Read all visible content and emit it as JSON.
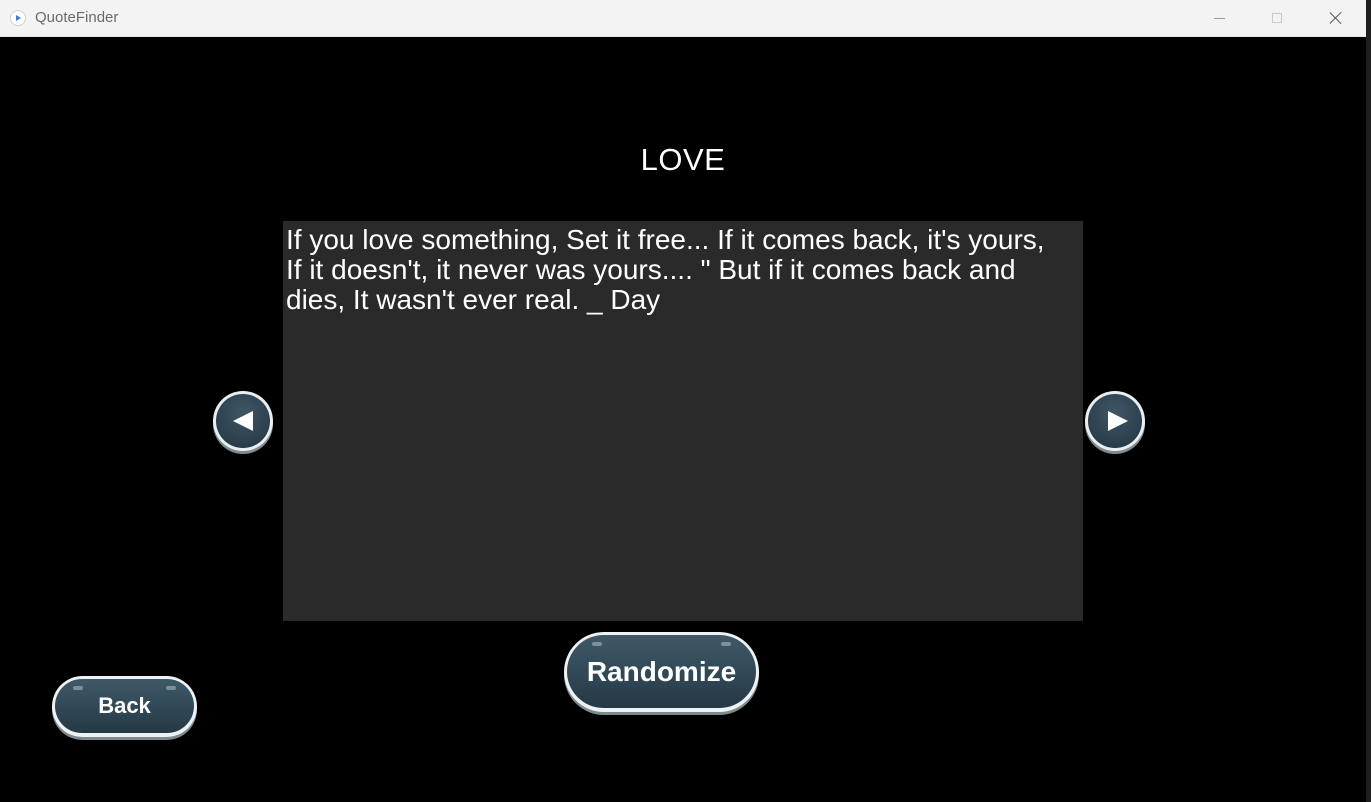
{
  "window": {
    "title": "QuoteFinder"
  },
  "main": {
    "category": "LOVE",
    "quote": "If you love something, Set it free... If it comes back, it's yours, If it doesn't, it never was yours.... \" But if it comes back and dies, It wasn't ever real. _ Day"
  },
  "buttons": {
    "randomize": "Randomize",
    "back": "Back"
  },
  "icons": {
    "previous": "left-arrow-icon",
    "next": "right-arrow-icon",
    "app": "app-play-icon"
  },
  "colors": {
    "background": "#000000",
    "panel": "#2a2a2a",
    "button_fill": "#304856",
    "button_border": "#eef2f3",
    "text": "#ffffff"
  }
}
